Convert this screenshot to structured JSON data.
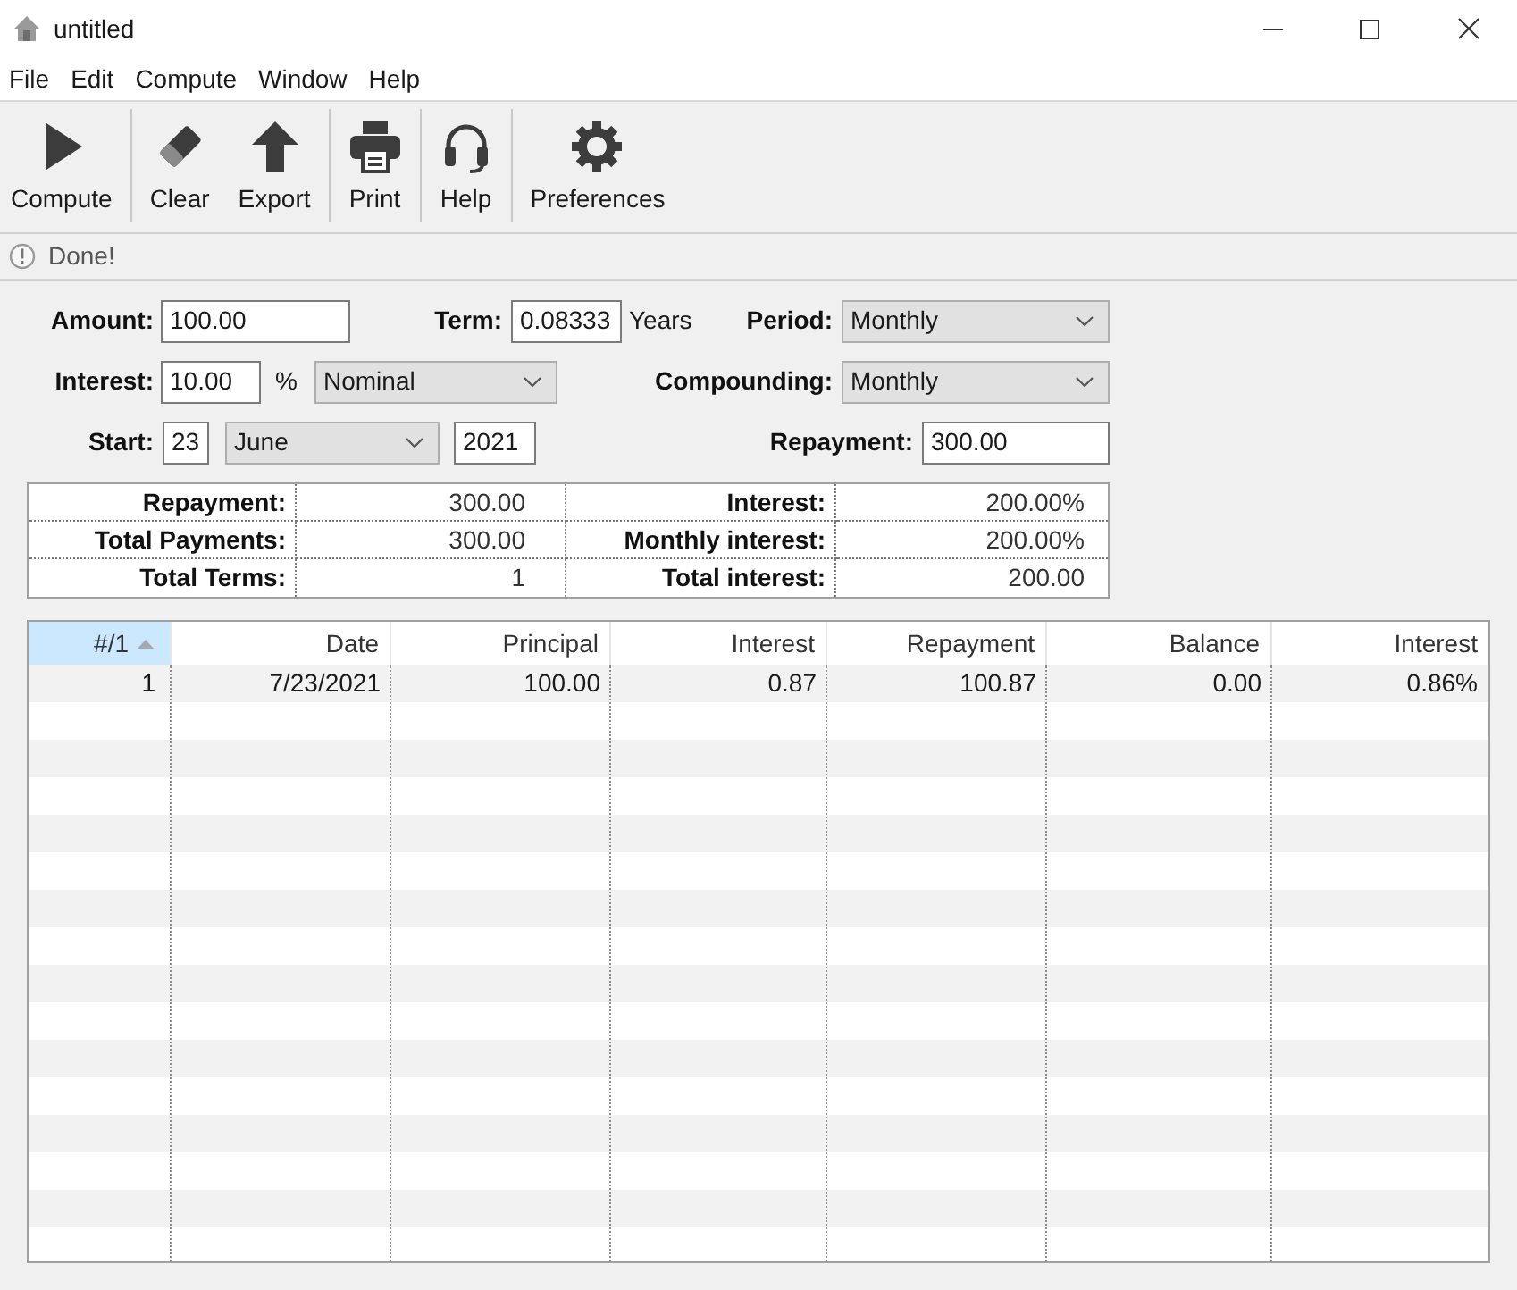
{
  "window": {
    "title": "untitled"
  },
  "menu": [
    "File",
    "Edit",
    "Compute",
    "Window",
    "Help"
  ],
  "toolbar": [
    [
      "Compute"
    ],
    [
      "Clear",
      "Export"
    ],
    [
      "Print"
    ],
    [
      "Help"
    ],
    [
      "Preferences"
    ]
  ],
  "status_bar": {
    "text": "Done!"
  },
  "form": {
    "amount": {
      "label": "Amount:",
      "value": "100.00"
    },
    "term": {
      "label": "Term:",
      "value": "0.08333",
      "unit": "Years"
    },
    "period": {
      "label": "Period:",
      "value": "Monthly"
    },
    "interest": {
      "label": "Interest:",
      "value": "10.00",
      "unit": "%",
      "rate_type": "Nominal"
    },
    "compounding": {
      "label": "Compounding:",
      "value": "Monthly"
    },
    "start": {
      "label": "Start:",
      "day": "23",
      "month": "June",
      "year": "2021"
    },
    "repayment": {
      "label": "Repayment:",
      "value": "300.00"
    }
  },
  "summary": {
    "rows": [
      [
        {
          "label": "Repayment:",
          "value": "300.00"
        },
        {
          "label": "Interest:",
          "value": "200.00%"
        }
      ],
      [
        {
          "label": "Total Payments:",
          "value": "300.00"
        },
        {
          "label": "Monthly interest:",
          "value": "200.00%"
        }
      ],
      [
        {
          "label": "Total Terms:",
          "value": "1"
        },
        {
          "label": "Total interest:",
          "value": "200.00"
        }
      ]
    ]
  },
  "table": {
    "columns": [
      {
        "label": "#/1",
        "sorted": true
      },
      {
        "label": "Date",
        "sorted": false
      },
      {
        "label": "Principal",
        "sorted": false
      },
      {
        "label": "Interest",
        "sorted": false
      },
      {
        "label": "Repayment",
        "sorted": false
      },
      {
        "label": "Balance",
        "sorted": false
      },
      {
        "label": "Interest",
        "sorted": false
      }
    ],
    "rows": [
      [
        "1",
        "7/23/2021",
        "100.00",
        "0.87",
        "100.87",
        "0.00",
        "0.86%"
      ]
    ]
  }
}
